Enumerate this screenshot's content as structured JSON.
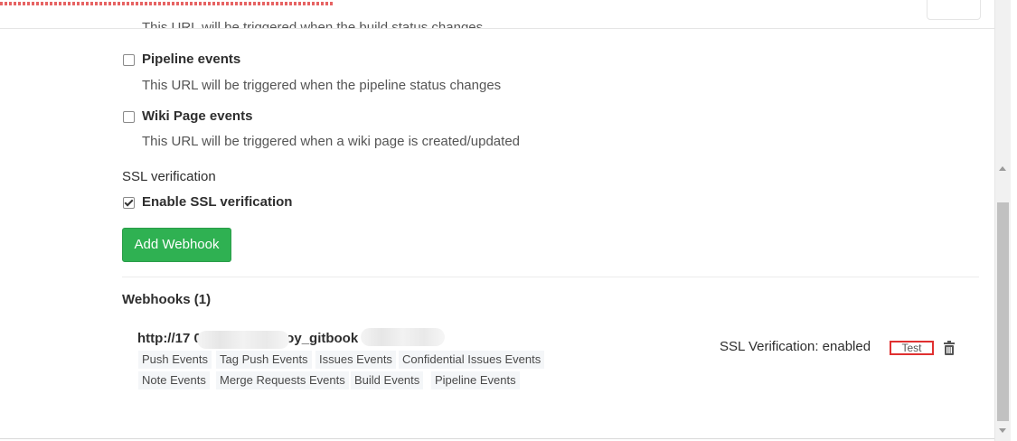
{
  "header": {
    "cut_text": "This URL will be triggered when the build status changes"
  },
  "events": [
    {
      "label": "Pipeline events",
      "description": "This URL will be triggered when the pipeline status changes",
      "checked": false
    },
    {
      "label": "Wiki Page events",
      "description": "This URL will be triggered when a wiki page is created/updated",
      "checked": false
    }
  ],
  "ssl": {
    "section_label": "SSL verification",
    "checkbox_label": "Enable SSL verification",
    "checked": true
  },
  "actions": {
    "add_webhook": "Add Webhook"
  },
  "webhooks": {
    "title": "Webhooks (1)",
    "items": [
      {
        "url": "http://17            0/project/u              eploy_gitbook",
        "tags": [
          "Push Events",
          "Tag Push Events",
          "Issues Events",
          "Confidential Issues Events",
          "Note Events",
          "Merge Requests Events",
          "Build Events",
          "Pipeline Events"
        ],
        "ssl_status": "SSL Verification: enabled",
        "test_label": "Test"
      }
    ]
  },
  "colors": {
    "accent_green": "#2fb152",
    "highlight_red": "#e03030",
    "tag_background": "#f4f6f8"
  }
}
